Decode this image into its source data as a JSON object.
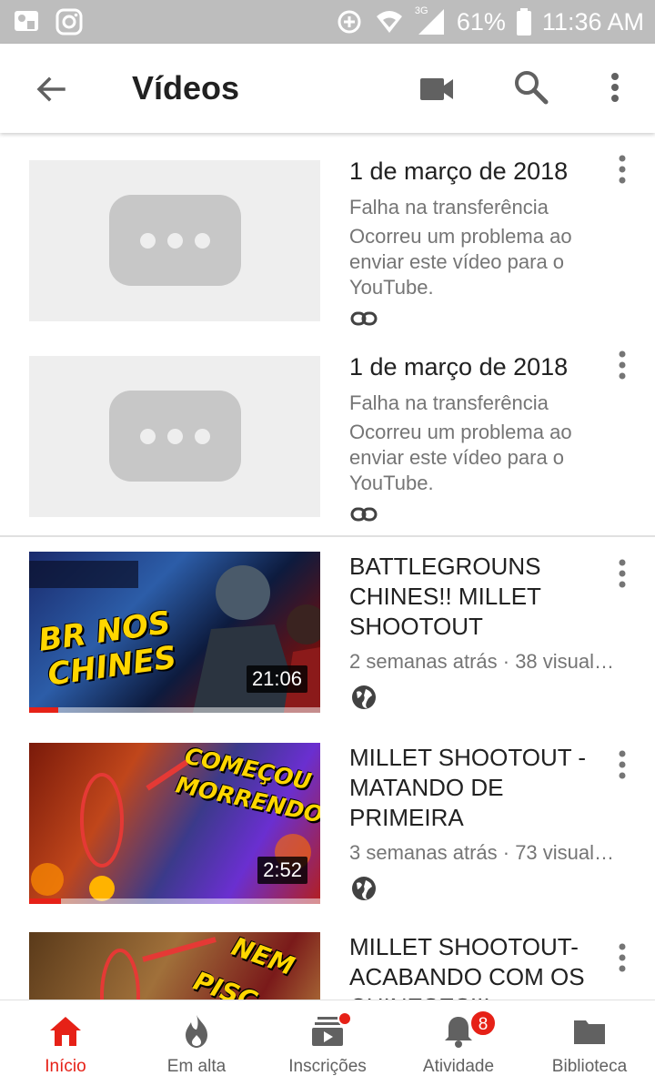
{
  "status_bar": {
    "network": "3G",
    "battery": "61%",
    "time": "11:36 AM"
  },
  "app_bar": {
    "title": "Vídeos"
  },
  "uploads": [
    {
      "date": "1 de março de 2018",
      "status": "Falha na transferência",
      "message": "Ocorreu um problema ao enviar este vídeo para o YouTube."
    },
    {
      "date": "1 de março de 2018",
      "status": "Falha na transferência",
      "message": "Ocorreu um problema ao enviar este vídeo para o YouTube."
    }
  ],
  "videos": [
    {
      "title": "BATTLEGROUNS CHINES!! MILLET SHOOTOUT",
      "meta": "2 semanas atrás · 38 visual…",
      "duration": "21:06",
      "thumb_text": [
        "BR NOS",
        "CHINES"
      ],
      "watched_fraction": 0.1
    },
    {
      "title": "MILLET SHOOTOUT - MATANDO DE PRIMEIRA",
      "meta": "3 semanas atrás · 73 visual…",
      "duration": "2:52",
      "thumb_text": [
        "COMEÇOU",
        "MORRENDO"
      ],
      "watched_fraction": 0.11
    },
    {
      "title": "MILLET SHOOTOUT- ACABANDO COM OS CHINESES!!!",
      "thumb_text": [
        "NEM",
        "PISC"
      ]
    }
  ],
  "bottom_nav": {
    "items": [
      {
        "label": "Início",
        "icon": "home-icon"
      },
      {
        "label": "Em alta",
        "icon": "trending-icon"
      },
      {
        "label": "Inscrições",
        "icon": "subscriptions-icon"
      },
      {
        "label": "Atividade",
        "icon": "bell-icon",
        "badge": "8"
      },
      {
        "label": "Biblioteca",
        "icon": "folder-icon"
      }
    ]
  },
  "colors": {
    "accent": "#e62117",
    "status_bar": "#bdbdbd",
    "secondary_text": "#757575"
  }
}
